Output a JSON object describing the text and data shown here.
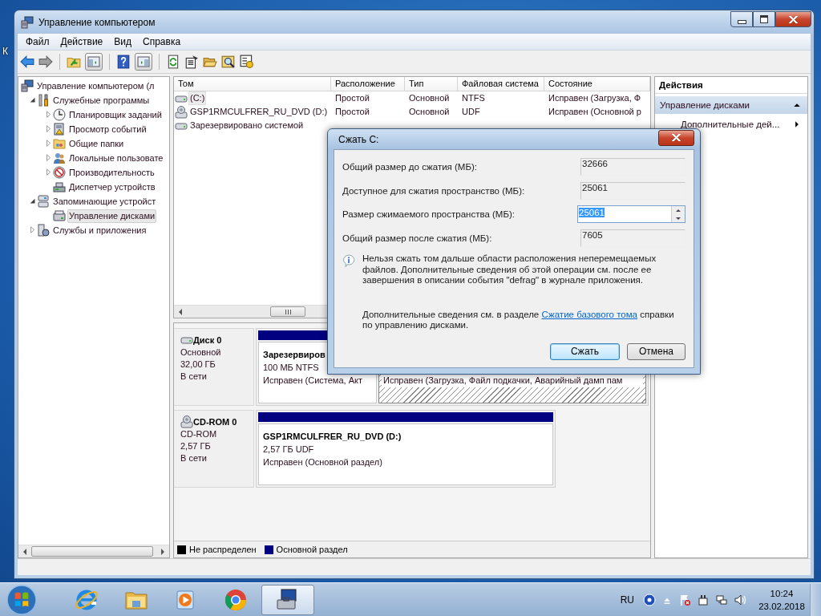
{
  "desktop": {
    "icon_label": "К"
  },
  "window": {
    "title": "Управление компьютером"
  },
  "menu": [
    "Файл",
    "Действие",
    "Вид",
    "Справка"
  ],
  "tree": [
    {
      "label": "Управление компьютером (л",
      "selected": false,
      "children": [
        {
          "label": "Служебные программы",
          "expanded": true,
          "selected": false,
          "children": [
            {
              "label": "Планировщик заданий",
              "expanded": false,
              "selected": false
            },
            {
              "label": "Просмотр событий",
              "expanded": false,
              "selected": false
            },
            {
              "label": "Общие папки",
              "expanded": false,
              "selected": false
            },
            {
              "label": "Локальные пользовате",
              "expanded": false,
              "selected": false
            },
            {
              "label": "Производительность",
              "expanded": false,
              "selected": false
            },
            {
              "label": "Диспетчер устройств",
              "selected": false
            }
          ]
        },
        {
          "label": "Запоминающие устройст",
          "expanded": true,
          "selected": false,
          "children": [
            {
              "label": "Управление дисками",
              "selected": true
            }
          ]
        },
        {
          "label": "Службы и приложения",
          "expanded": false,
          "selected": false
        }
      ]
    }
  ],
  "table": {
    "columns": [
      "Том",
      "Расположение",
      "Тип",
      "Файловая система",
      "Состояние"
    ],
    "rows": [
      {
        "kind": "disk",
        "volume": "(C:)",
        "layout": "Простой",
        "type": "Основной",
        "file_system": "NTFS",
        "status": "Исправен (Загрузка, Ф",
        "selected": true
      },
      {
        "kind": "cdrom",
        "volume": "GSP1RMCULFRER_RU_DVD (D:)",
        "layout": "Простой",
        "type": "Основной",
        "file_system": "UDF",
        "status": "Исправен (Основной р",
        "selected": false
      },
      {
        "kind": "disk",
        "volume": "Зарезервировано системой",
        "selected": false
      }
    ]
  },
  "disks": [
    {
      "kind": "disk",
      "name": "Диск 0",
      "type": "Основной",
      "size": "32,00 ГБ",
      "status": "В сети",
      "partitions": [
        {
          "name": "Зарезервиров",
          "size": "100 МБ NTFS",
          "status": "Исправен (Система, Акт",
          "selected": false
        },
        {
          "status": "Исправен (Загрузка, Файл подкачки, Аварийный дамп пам",
          "selected": true
        }
      ]
    },
    {
      "kind": "cdrom",
      "name": "CD-ROM 0",
      "type": "CD-ROM",
      "size": "2,57 ГБ",
      "status": "В сети",
      "partitions": [
        {
          "name": "GSP1RMCULFRER_RU_DVD  (D:)",
          "size": "2,57 ГБ UDF",
          "status": "Исправен (Основной раздел)",
          "selected": false
        }
      ]
    }
  ],
  "legend": [
    {
      "label": "Не распределен",
      "color": "#000000"
    },
    {
      "label": "Основной раздел",
      "color": "#000080"
    }
  ],
  "actions": {
    "title": "Действия",
    "section": "Управление дисками",
    "items": [
      "Дополнительные дей..."
    ]
  },
  "dialog": {
    "title": "Сжать C:",
    "fields": [
      {
        "kind": "readonly",
        "label": "Общий размер до сжатия (МБ):",
        "value": "32666"
      },
      {
        "kind": "readonly",
        "label": "Доступное для сжатия пространство (МБ):",
        "value": "25061"
      },
      {
        "kind": "spin",
        "label": "Размер сжимаемого пространства (МБ):",
        "value": "25061"
      },
      {
        "kind": "readonly",
        "label": "Общий размер после сжатия (МБ):",
        "value": "7605"
      }
    ],
    "note": "Нельзя сжать том дальше области расположения неперемещаемых файлов. Дополнительные сведения об этой операции см. после ее завершения в описании события \"defrag\" в журнале приложения.",
    "help_before": "Дополнительные сведения см. в разделе ",
    "help_link": "Сжатие базового тома",
    "help_after": " справки по управлению дисками.",
    "buttons": [
      {
        "label": "Сжать",
        "default": true
      },
      {
        "label": "Отмена",
        "default": false
      }
    ]
  },
  "taskbar": {
    "apps": [
      {
        "kind": "ie",
        "active": false
      },
      {
        "kind": "explorer",
        "active": false
      },
      {
        "kind": "media",
        "active": false
      },
      {
        "kind": "chrome",
        "active": false
      },
      {
        "kind": "compmgmt",
        "active": true
      }
    ],
    "language": "RU",
    "time": "10:24",
    "date": "23.02.2018"
  }
}
